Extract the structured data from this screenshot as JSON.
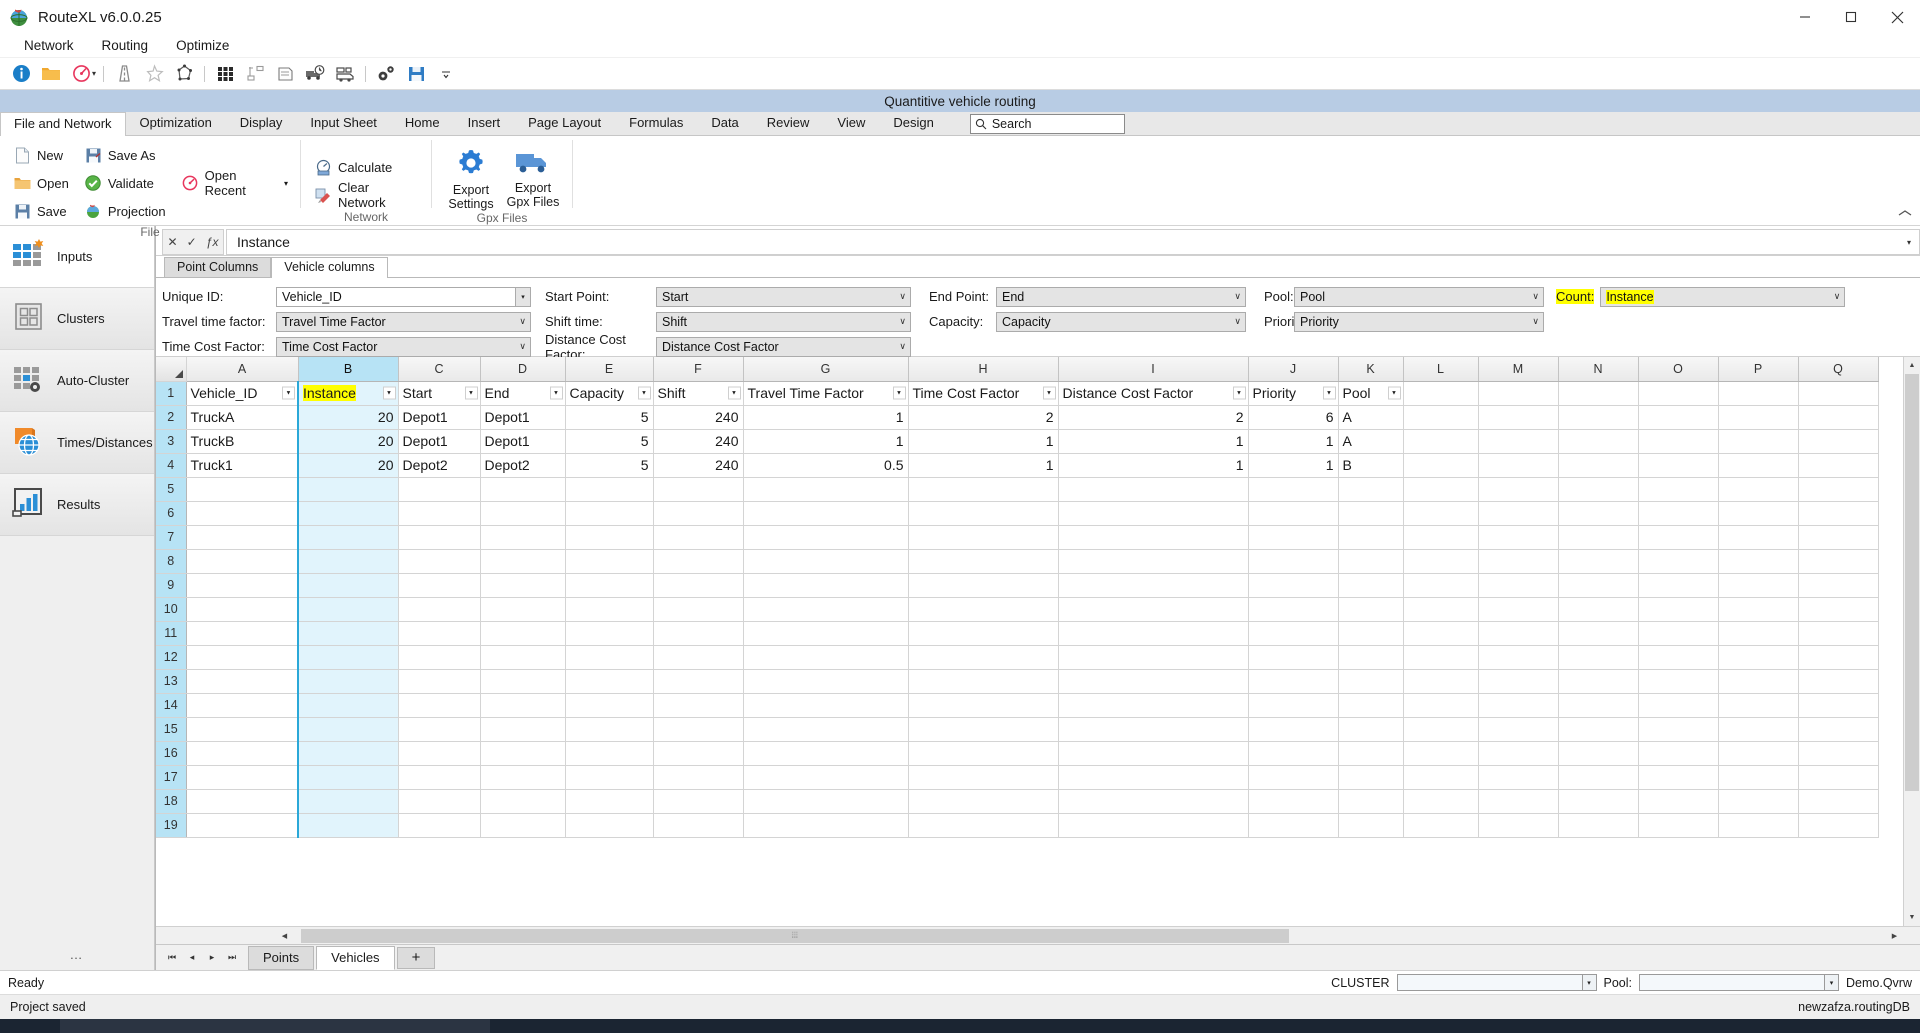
{
  "window": {
    "title": "RouteXL v6.0.0.25",
    "app_icon": "globe-app-icon",
    "minimize": "─",
    "maximize": "□",
    "close": "✕"
  },
  "menubar": {
    "items": [
      "Network",
      "Routing",
      "Optimize"
    ]
  },
  "quick_toolbar": {
    "icons": [
      "info-icon",
      "open-folder-icon",
      "speedometer-icon",
      "caret-down-icon",
      "separator",
      "road-icon",
      "star-outline-icon",
      "polygon-icon",
      "separator",
      "grid-dots-icon",
      "cluster-nodes-icon",
      "document-stack-icon",
      "truck-clock-icon",
      "truck-box-icon",
      "separator",
      "gears-icon",
      "save-disk-icon",
      "overflow-caret-icon"
    ]
  },
  "blue_caption": {
    "text": "Quantitive vehicle routing"
  },
  "ribbon": {
    "tabs": [
      {
        "label": "File and Network",
        "active": true
      },
      {
        "label": "Optimization",
        "active": false
      },
      {
        "label": "Display",
        "active": false
      },
      {
        "label": "Input Sheet",
        "active": false
      },
      {
        "label": "Home",
        "active": false
      },
      {
        "label": "Insert",
        "active": false
      },
      {
        "label": "Page Layout",
        "active": false
      },
      {
        "label": "Formulas",
        "active": false
      },
      {
        "label": "Data",
        "active": false
      },
      {
        "label": "Review",
        "active": false
      },
      {
        "label": "View",
        "active": false
      },
      {
        "label": "Design",
        "active": false
      }
    ],
    "search": {
      "placeholder": "Search",
      "icon": "search-icon"
    },
    "groups": [
      {
        "label": "File",
        "commands": [
          {
            "label": "New",
            "icon": "new-document-icon"
          },
          {
            "label": "Open",
            "icon": "open-folder-icon"
          },
          {
            "label": "Save",
            "icon": "save-disk-icon"
          },
          {
            "label": "Save As",
            "icon": "save-as-icon"
          },
          {
            "label": "Validate",
            "icon": "check-circle-icon"
          },
          {
            "label": "Projection",
            "icon": "globe-projection-icon"
          },
          {
            "label": "Open Recent",
            "icon": "recent-clock-icon",
            "has_caret": true
          }
        ]
      },
      {
        "label": "Network",
        "commands": [
          {
            "label": "Calculate",
            "icon": "calculator-ruler-icon"
          },
          {
            "label": "Clear Network",
            "icon": "clear-network-icon"
          }
        ]
      },
      {
        "label": "Gpx Files",
        "commands": [
          {
            "label": "Export Settings",
            "icon": "gear-icon"
          },
          {
            "label": "Export Gpx Files",
            "icon": "truck-icon"
          }
        ]
      }
    ],
    "collapse_icon": "collapse-ribbon-icon"
  },
  "sidebar": {
    "items": [
      {
        "label": "Inputs",
        "icon": "inputs-grid-icon",
        "active": true
      },
      {
        "label": "Clusters",
        "icon": "clusters-grid-icon",
        "active": false
      },
      {
        "label": "Auto-Cluster",
        "icon": "auto-cluster-gear-icon",
        "active": false
      },
      {
        "label": "Times/Distances",
        "icon": "times-distances-globe-icon",
        "active": false
      },
      {
        "label": "Results",
        "icon": "results-chart-icon",
        "active": false
      }
    ],
    "overflow": "…"
  },
  "formula_bar": {
    "cancel": "✕",
    "accept": "✓",
    "fx": "ƒx",
    "value": "Instance",
    "dropdown_icon": "chevron-down-icon"
  },
  "inner_tabs": [
    {
      "label": "Point Columns",
      "active": false
    },
    {
      "label": "Vehicle columns",
      "active": true
    }
  ],
  "mapping_form": {
    "fields": [
      {
        "label": "Unique ID:",
        "value": "Vehicle_ID",
        "style": "white",
        "highlight_label": false,
        "highlight_value": false
      },
      {
        "label": "Start Point:",
        "value": "Start",
        "style": "grey",
        "highlight_label": false,
        "highlight_value": false
      },
      {
        "label": "End Point:",
        "value": "End",
        "style": "grey",
        "highlight_label": false,
        "highlight_value": false
      },
      {
        "label": "Pool:",
        "value": "Pool",
        "style": "grey",
        "highlight_label": false,
        "highlight_value": false
      },
      {
        "label": "Count:",
        "value": "Instance",
        "style": "grey",
        "highlight_label": true,
        "highlight_value": true
      },
      {
        "label": "Travel time factor:",
        "value": "Travel Time Factor",
        "style": "grey",
        "highlight_label": false,
        "highlight_value": false
      },
      {
        "label": "Shift time:",
        "value": "Shift",
        "style": "grey",
        "highlight_label": false,
        "highlight_value": false
      },
      {
        "label": "Capacity:",
        "value": "Capacity",
        "style": "grey",
        "highlight_label": false,
        "highlight_value": false
      },
      {
        "label": "Priority",
        "value": "Priority",
        "style": "grey",
        "highlight_label": false,
        "highlight_value": false
      },
      {
        "label": "Time Cost Factor:",
        "value": "Time Cost Factor",
        "style": "grey",
        "highlight_label": false,
        "highlight_value": false
      },
      {
        "label": "Distance Cost Factor:",
        "value": "Distance Cost Factor",
        "style": "grey",
        "highlight_label": false,
        "highlight_value": false
      }
    ]
  },
  "spreadsheet": {
    "column_letters": [
      "A",
      "B",
      "C",
      "D",
      "E",
      "F",
      "G",
      "H",
      "I",
      "J",
      "K",
      "L",
      "M",
      "N",
      "O",
      "P",
      "Q"
    ],
    "selected_column": "B",
    "active_cell_value": "Instance",
    "header_row": [
      {
        "text": "Vehicle_ID",
        "filter": true,
        "highlight": false,
        "align": "left"
      },
      {
        "text": "Instance",
        "filter": true,
        "highlight": true,
        "align": "left"
      },
      {
        "text": "Start",
        "filter": true,
        "highlight": false,
        "align": "left"
      },
      {
        "text": "End",
        "filter": true,
        "highlight": false,
        "align": "left"
      },
      {
        "text": "Capacity",
        "filter": true,
        "highlight": false,
        "align": "left"
      },
      {
        "text": "Shift",
        "filter": true,
        "highlight": false,
        "align": "left"
      },
      {
        "text": "Travel Time Factor",
        "filter": true,
        "highlight": false,
        "align": "left"
      },
      {
        "text": "Time Cost Factor",
        "filter": true,
        "highlight": false,
        "align": "left"
      },
      {
        "text": "Distance Cost Factor",
        "filter": true,
        "highlight": false,
        "align": "left"
      },
      {
        "text": "Priority",
        "filter": true,
        "highlight": false,
        "align": "left"
      },
      {
        "text": "Pool",
        "filter": true,
        "highlight": false,
        "align": "left"
      },
      {
        "text": "",
        "filter": false,
        "highlight": false,
        "align": "left"
      },
      {
        "text": "",
        "filter": false,
        "highlight": false,
        "align": "left"
      },
      {
        "text": "",
        "filter": false,
        "highlight": false,
        "align": "left"
      },
      {
        "text": "",
        "filter": false,
        "highlight": false,
        "align": "left"
      },
      {
        "text": "",
        "filter": false,
        "highlight": false,
        "align": "left"
      },
      {
        "text": "",
        "filter": false,
        "highlight": false,
        "align": "left"
      }
    ],
    "rows": [
      {
        "n": 2,
        "cells": [
          "TruckA",
          "20",
          "Depot1",
          "Depot1",
          "5",
          "240",
          "1",
          "2",
          "2",
          "6",
          "A",
          "",
          "",
          "",
          "",
          "",
          ""
        ],
        "align": [
          "left",
          "right",
          "left",
          "left",
          "right",
          "right",
          "right",
          "right",
          "right",
          "right",
          "left",
          "",
          "",
          "",
          "",
          "",
          ""
        ]
      },
      {
        "n": 3,
        "cells": [
          "TruckB",
          "20",
          "Depot1",
          "Depot1",
          "5",
          "240",
          "1",
          "1",
          "1",
          "1",
          "A",
          "",
          "",
          "",
          "",
          "",
          ""
        ],
        "align": [
          "left",
          "right",
          "left",
          "left",
          "right",
          "right",
          "right",
          "right",
          "right",
          "right",
          "left",
          "",
          "",
          "",
          "",
          "",
          ""
        ]
      },
      {
        "n": 4,
        "cells": [
          "Truck1",
          "20",
          "Depot2",
          "Depot2",
          "5",
          "240",
          "0.5",
          "1",
          "1",
          "1",
          "B",
          "",
          "",
          "",
          "",
          "",
          ""
        ],
        "align": [
          "left",
          "right",
          "left",
          "left",
          "right",
          "right",
          "right",
          "right",
          "right",
          "right",
          "left",
          "",
          "",
          "",
          "",
          "",
          ""
        ]
      },
      {
        "n": 5,
        "cells": [
          "",
          "",
          "",
          "",
          "",
          "",
          "",
          "",
          "",
          "",
          "",
          "",
          "",
          "",
          "",
          "",
          ""
        ],
        "align": []
      },
      {
        "n": 6,
        "cells": [
          "",
          "",
          "",
          "",
          "",
          "",
          "",
          "",
          "",
          "",
          "",
          "",
          "",
          "",
          "",
          "",
          ""
        ],
        "align": []
      },
      {
        "n": 7,
        "cells": [
          "",
          "",
          "",
          "",
          "",
          "",
          "",
          "",
          "",
          "",
          "",
          "",
          "",
          "",
          "",
          "",
          ""
        ],
        "align": []
      },
      {
        "n": 8,
        "cells": [
          "",
          "",
          "",
          "",
          "",
          "",
          "",
          "",
          "",
          "",
          "",
          "",
          "",
          "",
          "",
          "",
          ""
        ],
        "align": []
      },
      {
        "n": 9,
        "cells": [
          "",
          "",
          "",
          "",
          "",
          "",
          "",
          "",
          "",
          "",
          "",
          "",
          "",
          "",
          "",
          "",
          ""
        ],
        "align": []
      },
      {
        "n": 10,
        "cells": [
          "",
          "",
          "",
          "",
          "",
          "",
          "",
          "",
          "",
          "",
          "",
          "",
          "",
          "",
          "",
          "",
          ""
        ],
        "align": []
      },
      {
        "n": 11,
        "cells": [
          "",
          "",
          "",
          "",
          "",
          "",
          "",
          "",
          "",
          "",
          "",
          "",
          "",
          "",
          "",
          "",
          ""
        ],
        "align": []
      },
      {
        "n": 12,
        "cells": [
          "",
          "",
          "",
          "",
          "",
          "",
          "",
          "",
          "",
          "",
          "",
          "",
          "",
          "",
          "",
          "",
          ""
        ],
        "align": []
      },
      {
        "n": 13,
        "cells": [
          "",
          "",
          "",
          "",
          "",
          "",
          "",
          "",
          "",
          "",
          "",
          "",
          "",
          "",
          "",
          "",
          ""
        ],
        "align": []
      },
      {
        "n": 14,
        "cells": [
          "",
          "",
          "",
          "",
          "",
          "",
          "",
          "",
          "",
          "",
          "",
          "",
          "",
          "",
          "",
          "",
          ""
        ],
        "align": []
      },
      {
        "n": 15,
        "cells": [
          "",
          "",
          "",
          "",
          "",
          "",
          "",
          "",
          "",
          "",
          "",
          "",
          "",
          "",
          "",
          "",
          ""
        ],
        "align": []
      },
      {
        "n": 16,
        "cells": [
          "",
          "",
          "",
          "",
          "",
          "",
          "",
          "",
          "",
          "",
          "",
          "",
          "",
          "",
          "",
          "",
          ""
        ],
        "align": []
      },
      {
        "n": 17,
        "cells": [
          "",
          "",
          "",
          "",
          "",
          "",
          "",
          "",
          "",
          "",
          "",
          "",
          "",
          "",
          "",
          "",
          ""
        ],
        "align": []
      },
      {
        "n": 18,
        "cells": [
          "",
          "",
          "",
          "",
          "",
          "",
          "",
          "",
          "",
          "",
          "",
          "",
          "",
          "",
          "",
          "",
          ""
        ],
        "align": []
      },
      {
        "n": 19,
        "cells": [
          "",
          "",
          "",
          "",
          "",
          "",
          "",
          "",
          "",
          "",
          "",
          "",
          "",
          "",
          "",
          "",
          ""
        ],
        "align": []
      }
    ]
  },
  "sheet_tabs": {
    "nav": [
      "⏮",
      "◂",
      "▸",
      "⏭"
    ],
    "tabs": [
      {
        "label": "Points",
        "active": false
      },
      {
        "label": "Vehicles",
        "active": true
      }
    ],
    "add": "+"
  },
  "status_bar": {
    "left": "Ready",
    "cluster_label": "CLUSTER",
    "cluster_value": "",
    "pool_label": "Pool:",
    "pool_value": "",
    "file_name": "Demo.Qvrw"
  },
  "status_bar2": {
    "left": "Project saved",
    "right": "newzafza.routingDB"
  },
  "colors": {
    "accent_blue": "#2b7cd3",
    "caption_blue": "#b8cce4",
    "highlight_yellow": "#ffff00",
    "selection_blue": "#b7e3f5",
    "selection_fill": "#e1f4fc",
    "orange": "#f0901e"
  }
}
